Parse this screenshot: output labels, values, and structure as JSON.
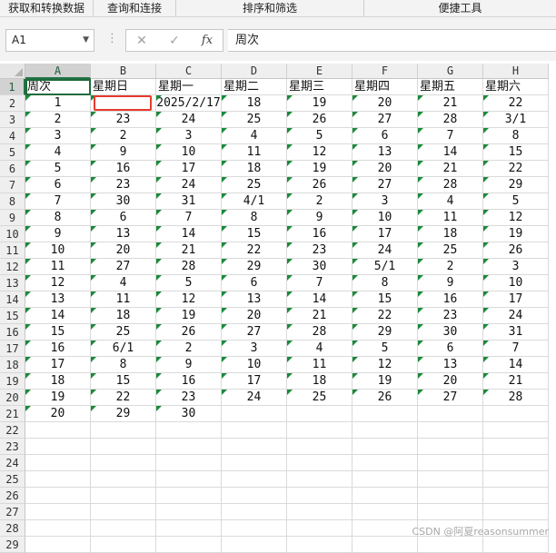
{
  "ribbon": {
    "groups": [
      "获取和转换数据",
      "查询和连接",
      "排序和筛选",
      "便捷工具"
    ]
  },
  "formula_bar": {
    "name_box": "A1",
    "cancel_icon": "✕",
    "enter_icon": "✓",
    "fx_label": "fx",
    "value": "周次"
  },
  "grid": {
    "columns": [
      "A",
      "B",
      "C",
      "D",
      "E",
      "F",
      "G",
      "H"
    ],
    "rows": [
      "1",
      "2",
      "3",
      "4",
      "5",
      "6",
      "7",
      "8",
      "9",
      "10",
      "11",
      "12",
      "13",
      "14",
      "15",
      "16",
      "17",
      "18",
      "19",
      "20",
      "21",
      "22",
      "23",
      "24",
      "25",
      "26",
      "27",
      "28",
      "29"
    ],
    "header_row": [
      "周次",
      "星期日",
      "星期一",
      "星期二",
      "星期三",
      "星期四",
      "星期五",
      "星期六"
    ],
    "data": [
      [
        "1",
        "",
        "2025/2/17",
        "18",
        "19",
        "20",
        "21",
        "22"
      ],
      [
        "2",
        "23",
        "24",
        "25",
        "26",
        "27",
        "28",
        "3/1"
      ],
      [
        "3",
        "2",
        "3",
        "4",
        "5",
        "6",
        "7",
        "8"
      ],
      [
        "4",
        "9",
        "10",
        "11",
        "12",
        "13",
        "14",
        "15"
      ],
      [
        "5",
        "16",
        "17",
        "18",
        "19",
        "20",
        "21",
        "22"
      ],
      [
        "6",
        "23",
        "24",
        "25",
        "26",
        "27",
        "28",
        "29"
      ],
      [
        "7",
        "30",
        "31",
        "4/1",
        "2",
        "3",
        "4",
        "5"
      ],
      [
        "8",
        "6",
        "7",
        "8",
        "9",
        "10",
        "11",
        "12"
      ],
      [
        "9",
        "13",
        "14",
        "15",
        "16",
        "17",
        "18",
        "19"
      ],
      [
        "10",
        "20",
        "21",
        "22",
        "23",
        "24",
        "25",
        "26"
      ],
      [
        "11",
        "27",
        "28",
        "29",
        "30",
        "5/1",
        "2",
        "3"
      ],
      [
        "12",
        "4",
        "5",
        "6",
        "7",
        "8",
        "9",
        "10"
      ],
      [
        "13",
        "11",
        "12",
        "13",
        "14",
        "15",
        "16",
        "17"
      ],
      [
        "14",
        "18",
        "19",
        "20",
        "21",
        "22",
        "23",
        "24"
      ],
      [
        "15",
        "25",
        "26",
        "27",
        "28",
        "29",
        "30",
        "31"
      ],
      [
        "16",
        "6/1",
        "2",
        "3",
        "4",
        "5",
        "6",
        "7"
      ],
      [
        "17",
        "8",
        "9",
        "10",
        "11",
        "12",
        "13",
        "14"
      ],
      [
        "18",
        "15",
        "16",
        "17",
        "18",
        "19",
        "20",
        "21"
      ],
      [
        "19",
        "22",
        "23",
        "24",
        "25",
        "26",
        "27",
        "28"
      ],
      [
        "20",
        "29",
        "30",
        "",
        "",
        "",
        "",
        ""
      ]
    ],
    "selected_cell": "A1",
    "highlighted_cell": "B2",
    "colors": {
      "accent": "#217346",
      "highlight": "#e83a2e",
      "error_triangle": "#1a8a3a"
    }
  },
  "watermark": "CSDN @阿夏reasonsummer"
}
